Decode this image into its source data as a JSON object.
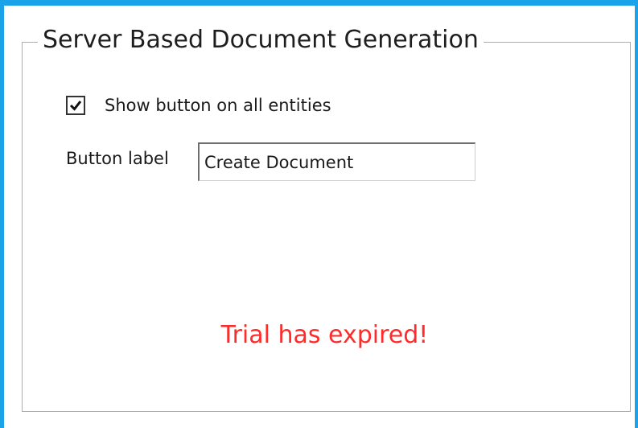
{
  "group": {
    "title": "Server Based Document Generation"
  },
  "show_button": {
    "label": "Show button on all entities",
    "checked": true
  },
  "button_label_field": {
    "label": "Button label",
    "value": "Create Document"
  },
  "status": {
    "message": "Trial has expired!",
    "color": "#ff2b2b"
  },
  "colors": {
    "window_border": "#1aa3e8",
    "group_border": "#adadad"
  }
}
